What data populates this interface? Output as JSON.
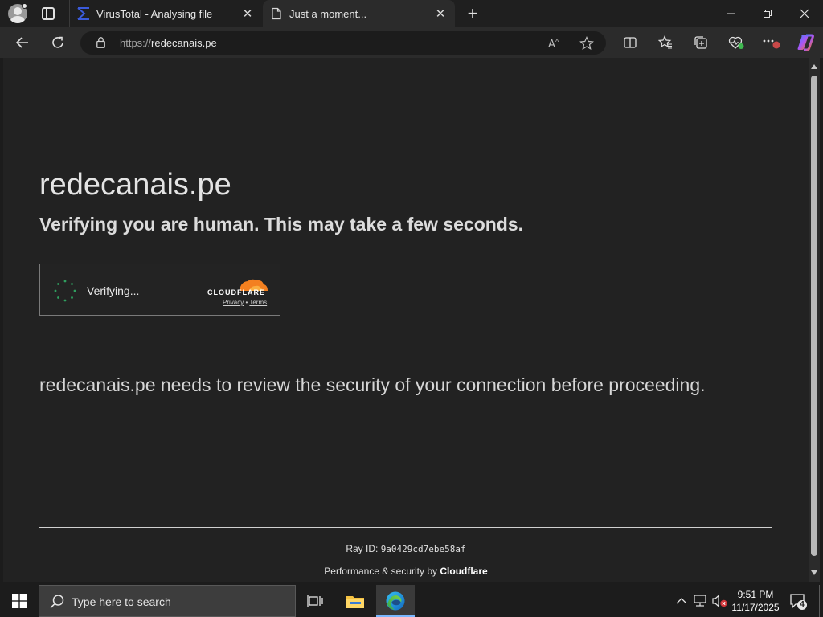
{
  "browser": {
    "tabs": [
      {
        "title": "VirusTotal - Analysing file",
        "favicon": "virustotal-icon",
        "active": false
      },
      {
        "title": "Just a moment...",
        "favicon": "page-icon",
        "active": true
      }
    ],
    "address": {
      "scheme": "https://",
      "host": "redecanais.pe"
    },
    "window_controls": {
      "minimize": "—",
      "restore": "❐",
      "close": "✕"
    },
    "icons": [
      "back-icon",
      "refresh-icon",
      "lock-icon",
      "read-aloud-icon",
      "favorite-star-icon",
      "split-screen-icon",
      "favorites-icon",
      "collections-icon",
      "browser-essentials-icon",
      "more-icon",
      "copilot-icon"
    ],
    "more_badge": "!"
  },
  "page": {
    "site_title": "redecanais.pe",
    "subtitle": "Verifying you are human. This may take a few seconds.",
    "widget": {
      "status": "Verifying...",
      "brand": "CLOUDFLARE",
      "privacy": "Privacy",
      "separator": "•",
      "terms": "Terms"
    },
    "notice": "redecanais.pe needs to review the security of your connection before proceeding.",
    "ray_label": "Ray ID: ",
    "ray_id": "9a0429cd7ebe58af",
    "perf_prefix": "Performance & security by ",
    "perf_brand": "Cloudflare"
  },
  "taskbar": {
    "search_placeholder": "Type here to search",
    "apps": [
      "task-view-icon",
      "file-explorer-icon",
      "edge-icon"
    ],
    "time": "9:51 PM",
    "date": "11/17/2025",
    "notification_count": "4"
  },
  "colors": {
    "page_bg": "#222222",
    "cloudflare_orange": "#f38020",
    "edge_blue": "#1ea7e6"
  }
}
